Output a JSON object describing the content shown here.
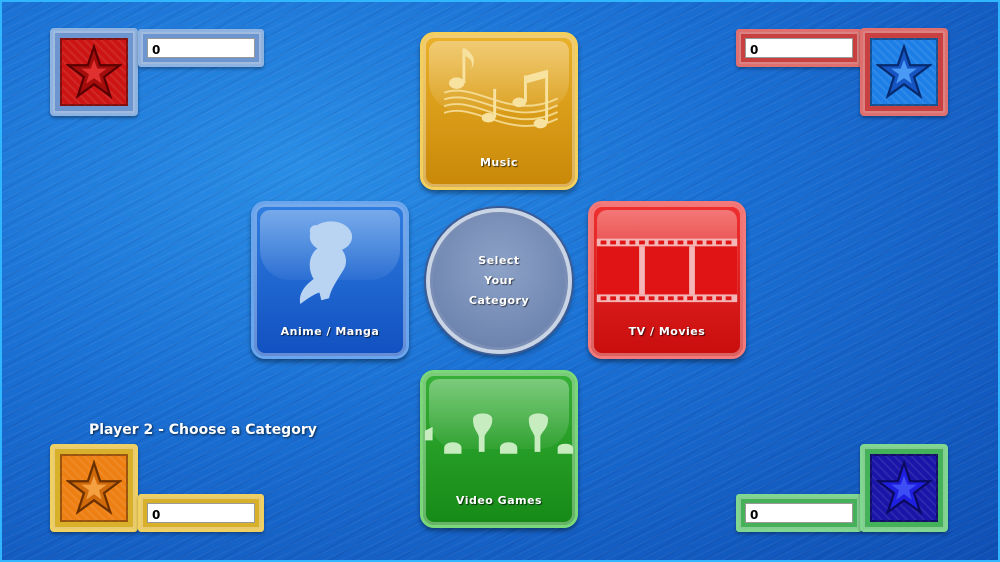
{
  "players": [
    {
      "id": "p1",
      "score": "0",
      "star_color": "#d11a1a",
      "frame_color": "#7aa3d8"
    },
    {
      "id": "p2",
      "score": "0",
      "star_color": "#f08a1c",
      "frame_color": "#e2bd35"
    },
    {
      "id": "p3",
      "score": "0",
      "star_color": "#1f6fe6",
      "frame_color": "#d94848"
    },
    {
      "id": "p4",
      "score": "0",
      "star_color": "#1d1fd0",
      "frame_color": "#55c26e"
    }
  ],
  "categories": [
    {
      "label": "Music",
      "color": "#e0a20e",
      "icon": "music-notes-icon"
    },
    {
      "label": "Anime / Manga",
      "color": "#1a5fd0",
      "icon": "anime-character-icon"
    },
    {
      "label": "TV / Movies",
      "color": "#e01a1a",
      "icon": "film-strip-icon"
    },
    {
      "label": "Video Games",
      "color": "#1f9e22",
      "icon": "game-characters-icon"
    }
  ],
  "center": {
    "line1": "Select",
    "line2": "Your",
    "line3": "Category"
  },
  "prompt": "Player 2 - Choose a Category"
}
